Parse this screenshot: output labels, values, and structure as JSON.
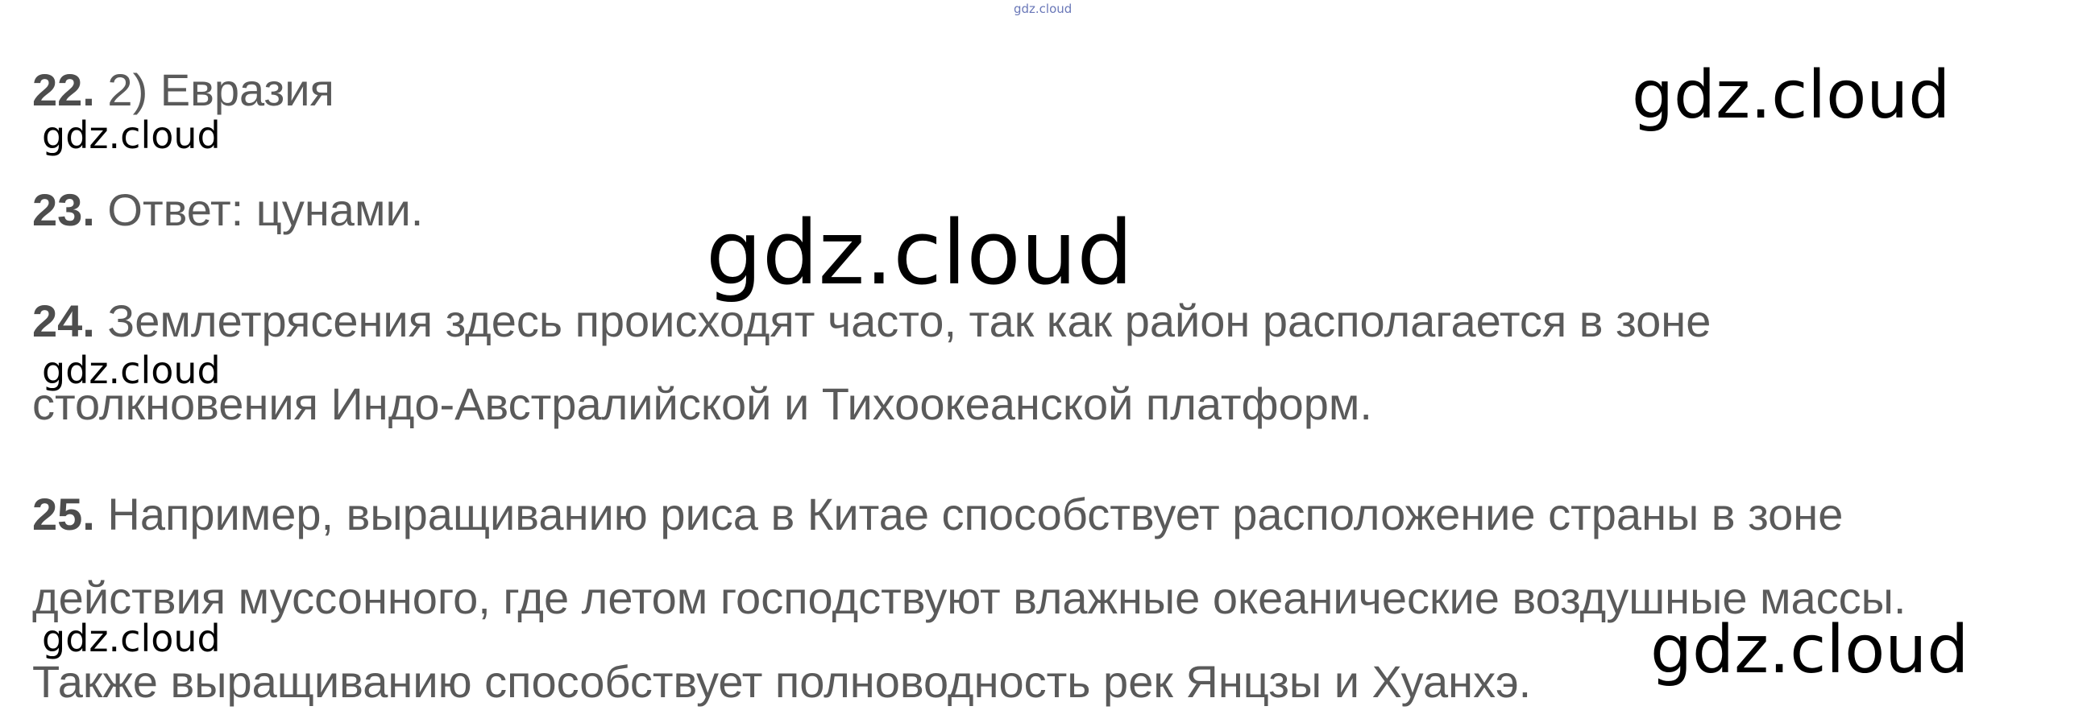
{
  "header_watermark": "gdz.cloud",
  "answers": [
    {
      "number": "22.",
      "lines": [
        " 2) Евразия"
      ]
    },
    {
      "number": "23.",
      "lines": [
        " Ответ: цунами."
      ]
    },
    {
      "number": "24.",
      "lines": [
        " Землетрясения здесь происходят часто, так как район располагается в зоне",
        "столкновения Индо-Австралийской и Тихоокеанской платформ."
      ]
    },
    {
      "number": "25.",
      "lines": [
        " Например, выращиванию риса в Китае способствует расположение страны в зоне",
        "действия муссонного, где летом господствуют влажные океанические воздушные массы.",
        "Также выращиванию способствует полноводность рек Янцзы и Хуанхэ."
      ]
    }
  ],
  "watermarks": {
    "small_1": "gdz.cloud",
    "small_2": "gdz.cloud",
    "small_3": "gdz.cloud",
    "medium_top_right": "gdz.cloud",
    "large_center": "gdz.cloud",
    "medium_bottom_right": "gdz.cloud"
  }
}
